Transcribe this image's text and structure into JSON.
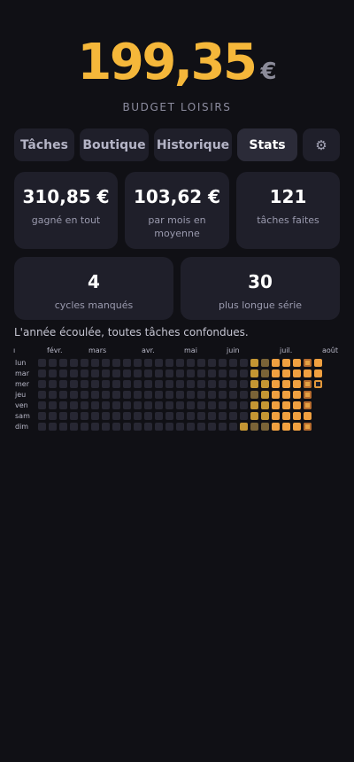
{
  "budget": {
    "amount": "199,35",
    "currency": "€",
    "label": "BUDGET LOISIRS"
  },
  "tabs": [
    {
      "label": "Tâches",
      "active": false
    },
    {
      "label": "Boutique",
      "active": false
    },
    {
      "label": "Historique",
      "active": false
    },
    {
      "label": "Stats",
      "active": true
    },
    {
      "label": "⚙",
      "icon": "gear-icon",
      "active": false
    }
  ],
  "stats": [
    {
      "value": "310,85 €",
      "label": "gagné en tout"
    },
    {
      "value": "103,62 €",
      "label": "par mois en moyenne"
    },
    {
      "value": "121",
      "label": "tâches faites"
    },
    {
      "value": "4",
      "label": "cycles manqués"
    },
    {
      "value": "30",
      "label": "plus longue série"
    }
  ],
  "heatmap": {
    "caption": "L'année écoulée, toutes tâches confondues.",
    "months": [
      "févr.",
      "mars",
      "avr.",
      "mai",
      "juin",
      "juil.",
      "août"
    ],
    "first_month_fragment": "ı",
    "days": [
      "lun",
      "mar",
      "mer",
      "jeu",
      "ven",
      "sam",
      "dim"
    ],
    "colors": {
      "empty": "#272733",
      "low": "#7a6337",
      "mid": "#c49633",
      "high": "#f0a040",
      "accent": "#f5b73a"
    }
  }
}
